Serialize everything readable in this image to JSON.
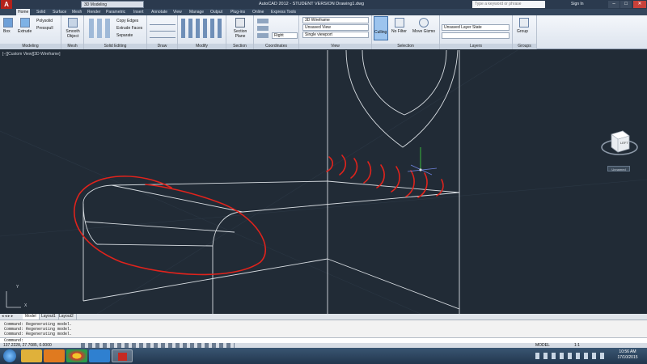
{
  "titlebar": {
    "app_letter": "A",
    "workspace": "3D Modeling",
    "title": "AutoCAD 2012 - STUDENT VERSION   Drawing1.dwg",
    "search_placeholder": "Type a keyword or phrase",
    "signin": "Sign In",
    "min": "–",
    "max": "□",
    "close": "✕"
  },
  "tabs": [
    "Home",
    "Solid",
    "Surface",
    "Mesh",
    "Render",
    "Parametric",
    "Insert",
    "Annotate",
    "View",
    "Manage",
    "Output",
    "Plug-ins",
    "Online",
    "Express Tools"
  ],
  "ribbon": {
    "modeling": {
      "title": "Modeling",
      "box": "Box",
      "extrude": "Extrude",
      "polysolid": "Polysolid",
      "presspull": "Presspull"
    },
    "mesh": {
      "title": "Mesh",
      "smooth": "Smooth Object"
    },
    "solid_editing": {
      "title": "Solid Editing",
      "copy_edges": "Copy Edges",
      "extrude_faces": "Extrude Faces",
      "separate": "Separate"
    },
    "draw": {
      "title": "Draw"
    },
    "modify": {
      "title": "Modify"
    },
    "section": {
      "title": "Section",
      "plane": "Section Plane"
    },
    "coordinates": {
      "title": "Coordinates",
      "right": "Right"
    },
    "view": {
      "title": "View",
      "visual_style": "3D Wireframe",
      "named_view": "Unsaved View",
      "viewport": "Single viewport"
    },
    "selection": {
      "title": "Selection",
      "culling": "Culling",
      "no_filter": "No Filter",
      "move_gizmo": "Move Gizmo"
    },
    "layers": {
      "title": "Layers",
      "layer_state": "Unsaved Layer State"
    },
    "groups": {
      "title": "Groups",
      "group": "Group"
    }
  },
  "viewport": {
    "label": "[−][Custom View][3D Wireframe]",
    "viewcube_face": "LEFT",
    "ucs_menu": "Unnamed",
    "ucs_y": "Y",
    "ucs_x": "X"
  },
  "layout_tabs": [
    "Model",
    "Layout1",
    "Layout2"
  ],
  "command": {
    "history": [
      "Command:  Regenerating model.",
      "Command:  Regenerating model.",
      "Command:  Regenerating model."
    ],
    "prompt": "Command:"
  },
  "status": {
    "coords": "137.2228, 27.7085, 0.0000",
    "model": "MODEL",
    "scale": "1:1"
  },
  "taskbar": {
    "time": "10:56 AM",
    "date": "17/10/2015"
  },
  "colors": {
    "viewport_bg": "#212b36",
    "wire": "#d8dde2",
    "annotation": "#e0231c",
    "app_red": "#b3221b"
  }
}
